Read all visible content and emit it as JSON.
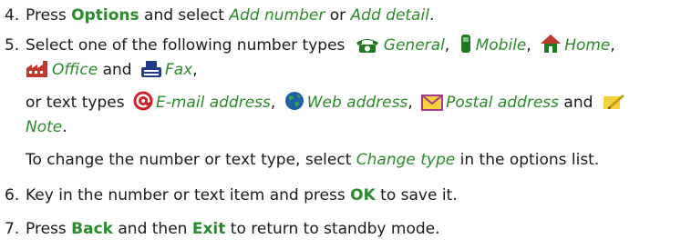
{
  "steps": [
    {
      "number": "4.",
      "t1": "Press ",
      "k1": "Options",
      "t2": " and select ",
      "i1": "Add number",
      "t3": " or ",
      "i2": "Add detail",
      "t4": "."
    },
    {
      "number": "5.",
      "line1": {
        "t1": "Select one of the following number types ",
        "general": "General",
        "mobile": "Mobile",
        "home": "Home"
      },
      "line2": {
        "office": "Office",
        "and": " and ",
        "fax": "Fax"
      },
      "line3": {
        "t1": "or text types ",
        "email": "E-mail address",
        "web": "Web address",
        "postal": "Postal address",
        "and": " and "
      },
      "line4": {
        "note": "Note"
      },
      "line5": {
        "t1": "To change the number or text type, select ",
        "change_type": "Change type",
        "t2": " in the options list."
      }
    },
    {
      "number": "6.",
      "t1": "Key in the number or text item and press ",
      "k1": "OK",
      "t2": " to save it."
    },
    {
      "number": "7.",
      "t1": "Press ",
      "k1": "Back",
      "t2": " and then ",
      "k2": "Exit",
      "t3": " to return to standby mode."
    }
  ],
  "icons": [
    "phone-icon",
    "mobile-icon",
    "home-icon",
    "office-icon",
    "fax-icon",
    "email-icon",
    "web-icon",
    "postal-icon",
    "note-icon"
  ],
  "colors": {
    "accent": "#2b8a2b",
    "text": "#1a1a1a"
  }
}
